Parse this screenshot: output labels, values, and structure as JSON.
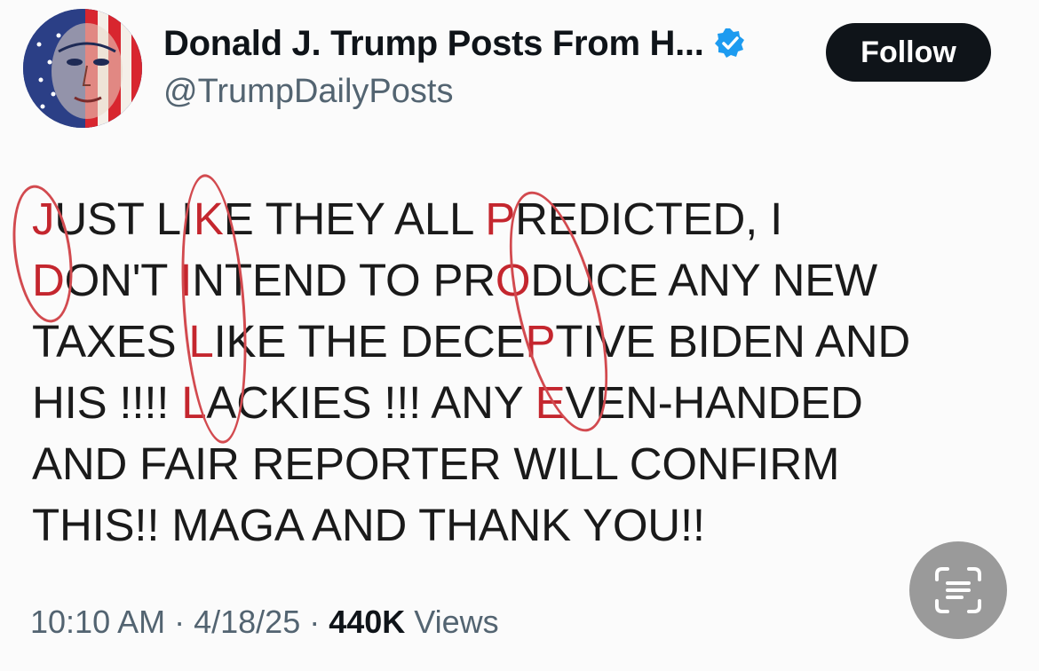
{
  "account": {
    "display_name": "Donald J. Trump Posts From H...",
    "handle": "@TrumpDailyPosts",
    "verified_icon": "verified-badge-icon",
    "follow_label": "Follow"
  },
  "post": {
    "lines": [
      [
        "",
        "J",
        "UST LI",
        "K",
        "E THEY ALL ",
        "P",
        "REDICTED, I"
      ],
      [
        "",
        "D",
        "ON'T ",
        "I",
        "NTEND TO PR",
        "O",
        "DUCE ANY NEW"
      ],
      [
        "TAXES ",
        "L",
        "IKE THE DECE",
        "P",
        "TIVE BIDEN AND"
      ],
      [
        "HIS !!!! ",
        "L",
        "ACKIES !!! ANY ",
        "E",
        "VEN-HANDED"
      ],
      [
        "AND FAIR REPORTER WILL CONFIRM"
      ],
      [
        "THIS!! MAGA AND THANK YOU!!"
      ]
    ],
    "time": "10:10 AM",
    "sep1": " · ",
    "date": "4/18/25",
    "sep2": " · ",
    "views_count": "440K",
    "views_label": " Views"
  },
  "colors": {
    "highlight": "#c4262e",
    "annotation": "#d24a4f",
    "button_bg": "#0f1419",
    "verified": "#1d9bf0"
  },
  "icons": {
    "scan": "text-scan-icon"
  }
}
